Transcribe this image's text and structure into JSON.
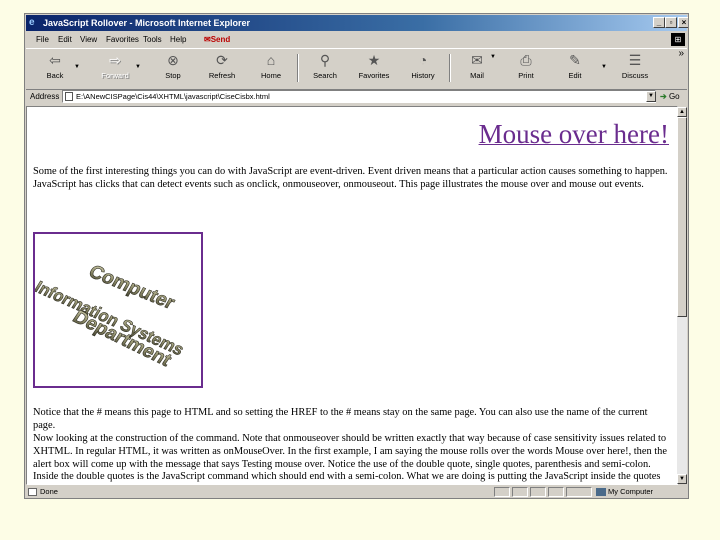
{
  "window": {
    "title": "JavaScript Rollover - Microsoft Internet Explorer",
    "controls": [
      "_",
      "▫",
      "×"
    ]
  },
  "menu": {
    "items": [
      "File",
      "Edit",
      "View",
      "Favorites",
      "Tools",
      "Help"
    ],
    "send_label": "Send"
  },
  "toolbar": {
    "buttons": [
      {
        "label": "Back",
        "icon": "back-arrow-icon",
        "glyph": "⇦"
      },
      {
        "label": "Forward",
        "icon": "forward-arrow-icon",
        "glyph": "⇨"
      },
      {
        "label": "Stop",
        "icon": "stop-icon",
        "glyph": "⊗"
      },
      {
        "label": "Refresh",
        "icon": "refresh-icon",
        "glyph": "⟳"
      },
      {
        "label": "Home",
        "icon": "home-icon",
        "glyph": "⌂"
      },
      {
        "label": "Search",
        "icon": "search-icon",
        "glyph": "⚲"
      },
      {
        "label": "Favorites",
        "icon": "favorites-icon",
        "glyph": "★"
      },
      {
        "label": "History",
        "icon": "history-icon",
        "glyph": "◔"
      },
      {
        "label": "Mail",
        "icon": "mail-icon",
        "glyph": "✉"
      },
      {
        "label": "Print",
        "icon": "print-icon",
        "glyph": "⎙"
      },
      {
        "label": "Edit",
        "icon": "edit-icon",
        "glyph": "✎"
      },
      {
        "label": "Discuss",
        "icon": "discuss-icon",
        "glyph": "☰"
      }
    ],
    "more": "»"
  },
  "address": {
    "label": "Address",
    "url": "E:\\ANewCISPage\\Cis44\\XHTML\\javascript\\CiseCisbx.html",
    "go_label": "Go"
  },
  "page": {
    "heading_link": "Mouse over here!",
    "paragraph1": "Some of the first interesting things you can do with JavaScript are event-driven. Event driven means that a particular action causes something to happen. JavaScript has clicks that can detect events such as onclick, onmouseover, onmouseout. This page illustrates the mouse over and mouse out events.",
    "logo_lines": [
      "Computer",
      "Information Systems",
      "Department"
    ],
    "paragraph2": "Notice that the # means this page to HTML and so setting the HREF to the # means stay on the same page. You can also use the name of the current page.",
    "paragraph3": "Now looking at the construction of the command. Note that onmouseover should be written exactly that way because of case sensitivity issues related to XHTML. In regular HTML, it was written as onMouseOver. In the first example, I am saying the mouse rolls over the words Mouse over here!, then the alert box will come up with the message that says Testing mouse over. Notice the use of the double quote, single quotes, parenthesis and semi-colon. Inside the double quotes is the JavaScript command which should end with a semi-colon. What we are doing is putting the JavaScript inside the quotes of an event. The event is onmouseover."
  },
  "status": {
    "text": "Done",
    "zone": "My Computer"
  },
  "colors": {
    "link": "#6a2c8e",
    "titlebar": "#0a246a",
    "background": "#fdfde6"
  }
}
